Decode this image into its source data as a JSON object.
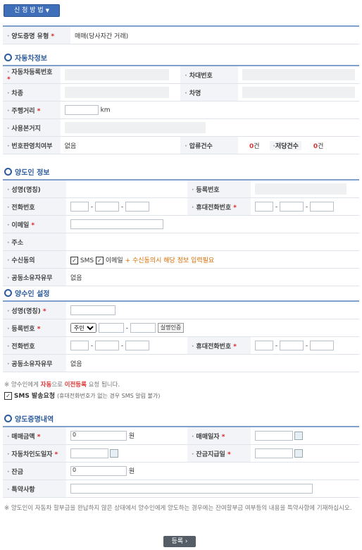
{
  "top_button": {
    "label": "신 청 방 법"
  },
  "transfer_type": {
    "label": "양도증명 유형",
    "value": "매매(당사자간 거래)"
  },
  "vehicle": {
    "title": "자동차정보",
    "reg_no_label": "자동차등록번호",
    "vin_label": "차대번호",
    "type_label": "차종",
    "name_label": "차명",
    "mileage_label": "주행거리",
    "mileage_unit": "km",
    "base_label": "사용본거지",
    "plate_label": "번호판영치여부",
    "plate_value": "없음",
    "seize_label": "압류건수",
    "seize_count": "0",
    "count_unit": "건",
    "mortgage_label": "저당건수",
    "mortgage_count": "0"
  },
  "seller": {
    "title": "양도인 정보",
    "name_label": "성명(명칭)",
    "reg_label": "등록번호",
    "phone_label": "전화번호",
    "mobile_label": "휴대전화번호",
    "email_label": "이메일",
    "addr_label": "주소",
    "consent_label": "수신동의",
    "sms": "SMS",
    "email_opt": "이메일",
    "consent_note": "+ 수신동의시 해당 정보 입력필요",
    "co_owner_label": "공동소유자유무",
    "co_owner_value": "없음"
  },
  "buyer": {
    "title": "양수인 설정",
    "name_label": "성명(명칭)",
    "reg_label": "등록번호",
    "reg_type": "주민",
    "verify_btn": "실명인증",
    "phone_label": "전화번호",
    "mobile_label": "휴대전화번호",
    "co_owner_label": "공동소유자유무",
    "co_owner_value": "없음"
  },
  "notice": {
    "pre": "※ 양수인에게 ",
    "auto": "자동",
    "mid": "으로 ",
    "transfer": "이전등록",
    "post": " 요청 됩니다.",
    "sms_label": "SMS 발송요청",
    "sms_note": "(휴대전화번호가 없는 경우 SMS 알림 불가)"
  },
  "details": {
    "title": "양도증명내역",
    "amount_label": "매매금액",
    "amount_value": "0",
    "won": "원",
    "date_label": "매매일자",
    "delivery_label": "자동차인도일자",
    "balance_date_label": "잔금지급일",
    "balance_label": "잔금",
    "balance_value": "0",
    "special_label": "특약사항"
  },
  "footer_note": "※ 양도인이 자동차 할부금을 완납하지 않은 상태에서 양수인에게 양도하는 경우에는 잔여할부금 여부등의 내용을 특약사항에 기재하십시오.",
  "submit": {
    "label": "등록"
  }
}
